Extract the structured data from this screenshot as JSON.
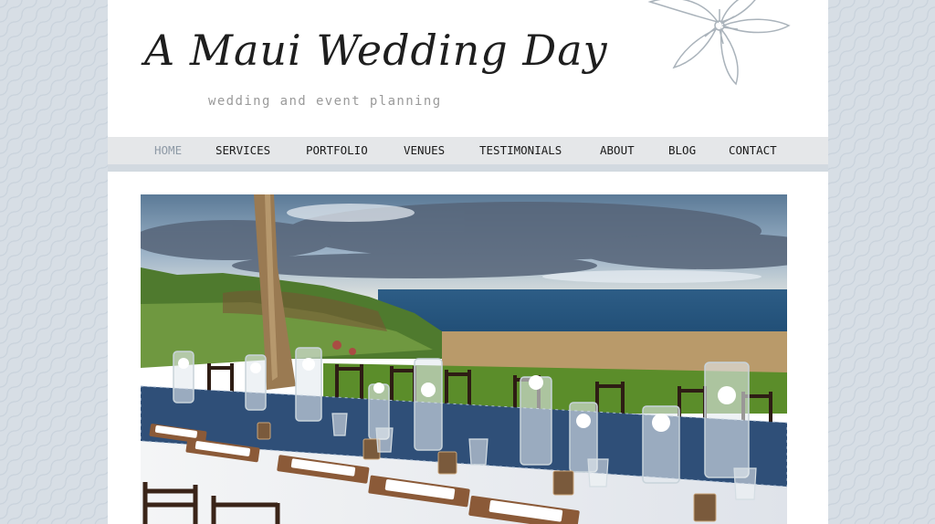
{
  "site": {
    "title": "A Maui Wedding Day",
    "tagline": "wedding and event planning"
  },
  "nav": {
    "items": [
      {
        "label": "HOME",
        "active": true
      },
      {
        "label": "SERVICES",
        "active": false
      },
      {
        "label": "PORTFOLIO",
        "active": false
      },
      {
        "label": "VENUES",
        "active": false
      },
      {
        "label": "TESTIMONIALS",
        "active": false
      },
      {
        "label": "ABOUT",
        "active": false
      },
      {
        "label": "BLOG",
        "active": false
      },
      {
        "label": "CONTACT",
        "active": false
      }
    ]
  },
  "colors": {
    "background": "#d7dee5",
    "nav_bar": "#e5e7e9",
    "nav_active": "#8e9aa6",
    "text": "#1a1a1a"
  },
  "icons": {
    "logo_decoration": "plumeria-flower-icon"
  },
  "hero": {
    "subject": "outdoor ocean-view wedding reception table"
  }
}
